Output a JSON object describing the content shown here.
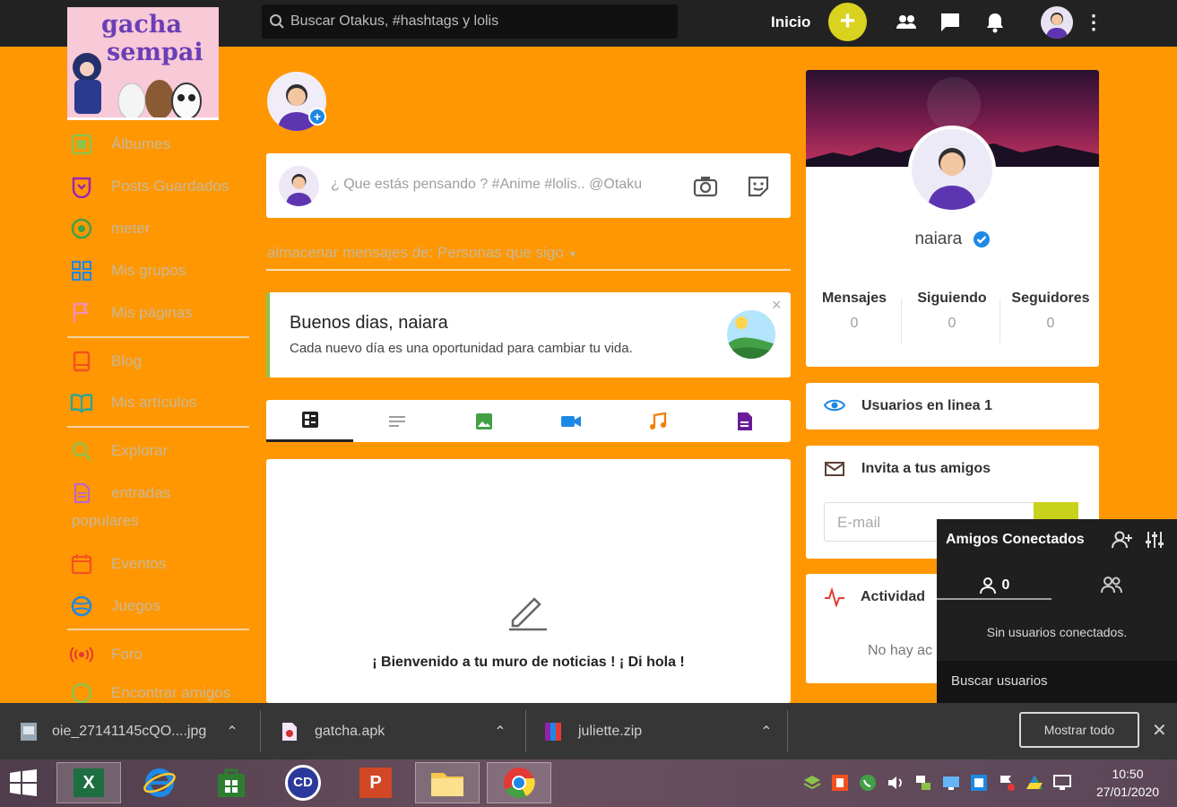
{
  "header": {
    "logo": {
      "line1": "gacha",
      "line2": "sempai"
    },
    "search_placeholder": "Buscar Otakus, #hashtags y lolis",
    "nav_home": "Inicio",
    "add_symbol": "+",
    "icons": [
      "users-icon",
      "chat-icon",
      "bell-icon",
      "avatar",
      "more-vert-icon"
    ]
  },
  "sidebar": {
    "items": [
      {
        "label": "Álbumes",
        "icon": "album-icon",
        "color": "#8bc34a"
      },
      {
        "label": "Posts Guardados",
        "icon": "bookmark-icon",
        "color": "#9c27b0"
      },
      {
        "label": "meter",
        "icon": "target-icon",
        "color": "#43a047"
      },
      {
        "label": "Mis grupos",
        "icon": "groups-icon",
        "color": "#1e88e5"
      },
      {
        "label": "Mis páginas",
        "icon": "flag-icon",
        "color": "#f48fb1"
      },
      {
        "label": "Blog",
        "icon": "blog-icon",
        "color": "#f4511e"
      },
      {
        "label": "Mis artículos",
        "icon": "book-icon",
        "color": "#26a69a"
      },
      {
        "label": "Explorar",
        "icon": "explore-icon",
        "color": "#8bc34a"
      },
      {
        "label": "entradas",
        "label2": "populares",
        "icon": "document-icon",
        "color": "#ba68c8"
      },
      {
        "label": "Eventos",
        "icon": "calendar-icon",
        "color": "#f4511e"
      },
      {
        "label": "Juegos",
        "icon": "games-icon",
        "color": "#1e88e5"
      },
      {
        "label": "Foro",
        "icon": "broadcast-icon",
        "color": "#e53935"
      },
      {
        "label": "Encontrar amigos",
        "icon": "find-friends-icon",
        "color": "#8bc34a"
      }
    ]
  },
  "composer": {
    "placeholder": "¿ Que estás pensando ? #Anime #lolis.. @Otaku",
    "icons": [
      "camera-icon",
      "sticker-icon"
    ]
  },
  "feed_filter": {
    "label": "almacenar mensajes de:",
    "value": "Personas que sigo"
  },
  "greeting": {
    "title": "Buenos dias, naiara",
    "subtitle": "Cada nuevo día es una oportunidad para cambiar tu vida.",
    "close": "×"
  },
  "post_tabs": [
    {
      "icon": "all-posts-icon",
      "color": "#222222",
      "active": true
    },
    {
      "icon": "text-icon",
      "color": "#9e9e9e"
    },
    {
      "icon": "image-icon",
      "color": "#43a047"
    },
    {
      "icon": "video-icon",
      "color": "#1e88e5"
    },
    {
      "icon": "music-icon",
      "color": "#f57c00"
    },
    {
      "icon": "file-icon",
      "color": "#6a1b9a"
    }
  ],
  "feed": {
    "empty_message": "¡ Bienvenido a tu muro de noticias ! ¡ Di hola !"
  },
  "profile": {
    "name": "naiara",
    "verified": true,
    "stats": [
      {
        "label": "Mensajes",
        "value": "0"
      },
      {
        "label": "Siguiendo",
        "value": "0"
      },
      {
        "label": "Seguidores",
        "value": "0"
      }
    ]
  },
  "online_users": {
    "label": "Usuarios en linea 1"
  },
  "invite": {
    "title": "Invita a tus amigos",
    "email_placeholder": "E-mail"
  },
  "activity": {
    "title": "Actividad",
    "empty_partial": "No hay ac"
  },
  "friends_panel": {
    "title": "Amigos Conectados",
    "online_count": "0",
    "empty": "Sin usuarios conectados.",
    "search": "Buscar usuarios"
  },
  "downloads": {
    "items": [
      {
        "name": "oie_27141145cQO....jpg"
      },
      {
        "name": "gatcha.apk"
      },
      {
        "name": "juliette.zip"
      }
    ],
    "show_all": "Mostrar todo"
  },
  "taskbar": {
    "apps": [
      "windows-start-icon",
      "excel-icon",
      "internet-explorer-icon",
      "store-icon",
      "cd-icon",
      "powerpoint-icon",
      "file-explorer-icon",
      "chrome-icon"
    ],
    "excel_letter": "X",
    "cd_text": "CD",
    "ppt_letter": "P",
    "time": "10:50",
    "date": "27/01/2020"
  },
  "colors": {
    "accent_orange": "#ff9702",
    "topbar": "#222222",
    "add_button": "#d9d21f",
    "verified_blue": "#1e88e5"
  }
}
